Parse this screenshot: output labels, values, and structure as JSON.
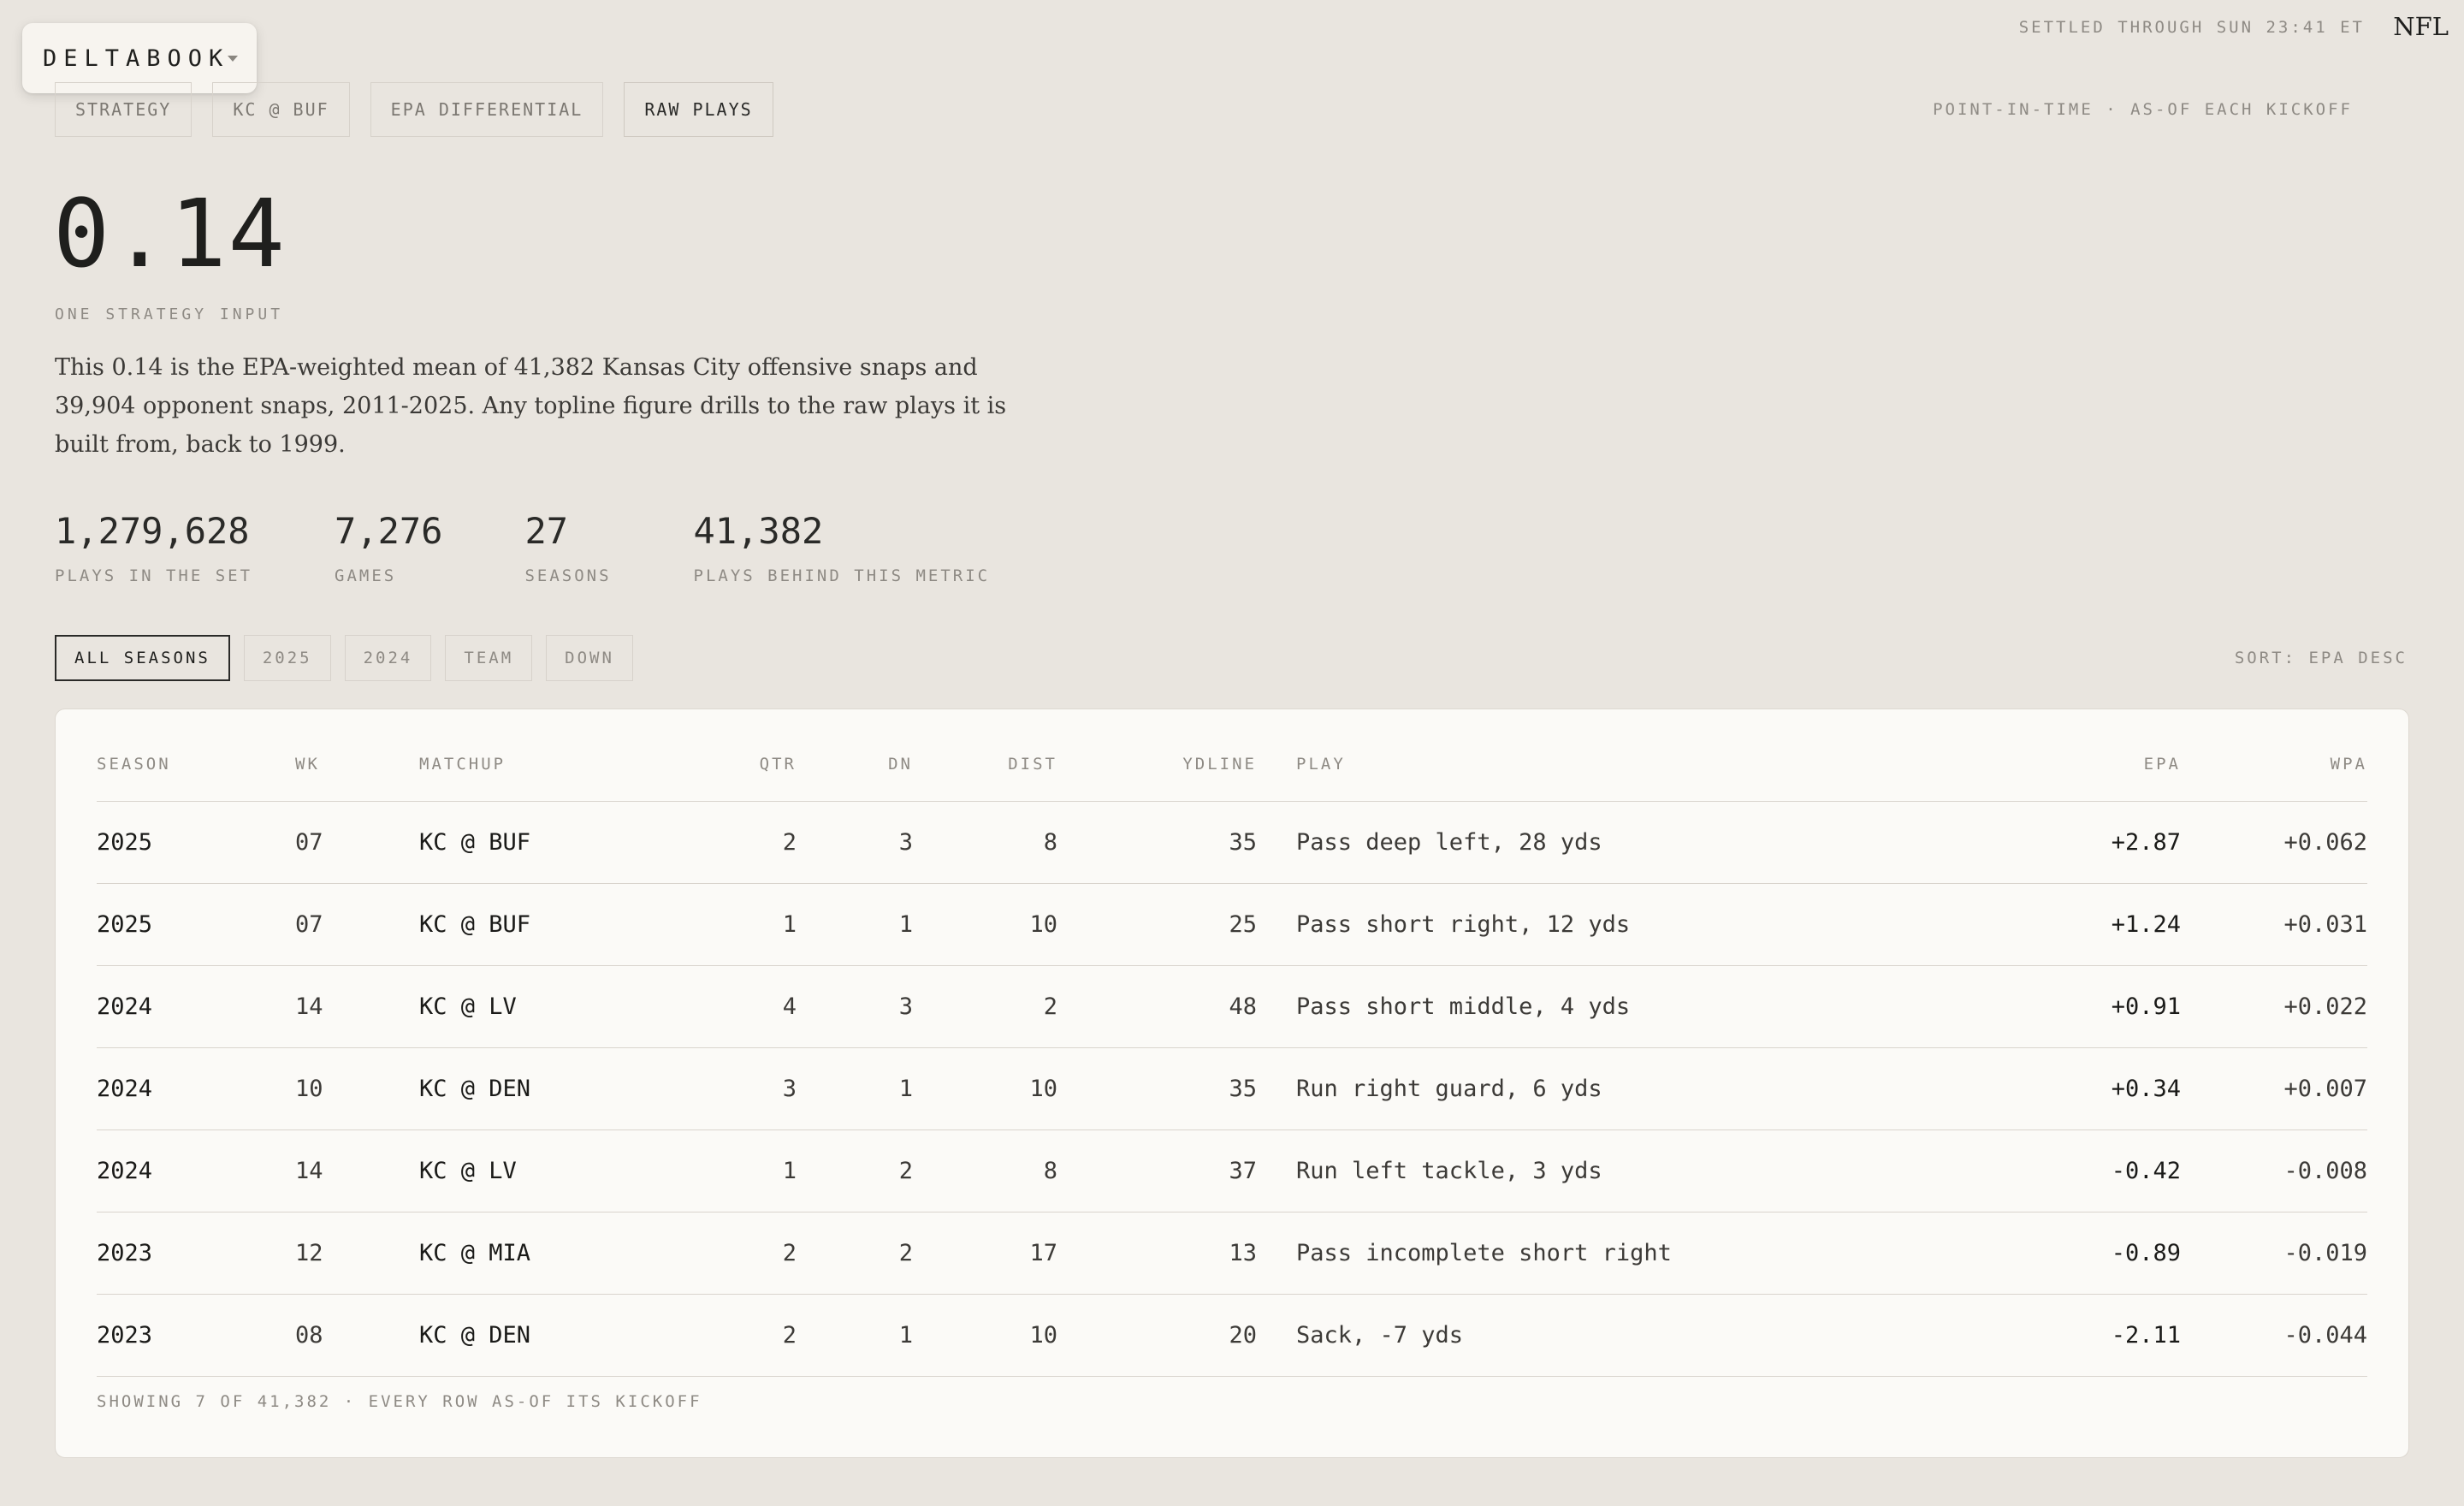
{
  "brand": {
    "name": "DELTABOOK",
    "caret_icon": "chevron-down-icon"
  },
  "status": {
    "settled": "SETTLED THROUGH SUN 23:41 ET",
    "league": "NFL"
  },
  "breadcrumbs": [
    {
      "label": "STRATEGY",
      "active": false
    },
    {
      "label": "KC @ BUF",
      "active": false
    },
    {
      "label": "EPA DIFFERENTIAL",
      "active": false
    },
    {
      "label": "RAW PLAYS",
      "active": true
    }
  ],
  "point_in_time": "POINT-IN-TIME · AS-OF EACH KICKOFF",
  "metric": {
    "value": "0.14",
    "caption": "ONE STRATEGY INPUT",
    "explainer": "This 0.14 is the EPA-weighted mean of 41,382 Kansas City offensive snaps and 39,904 opponent snaps, 2011-2025. Any topline figure drills to the raw plays it is built from, back to 1999."
  },
  "stats": [
    {
      "value": "1,279,628",
      "label": "PLAYS IN THE SET"
    },
    {
      "value": "7,276",
      "label": "GAMES"
    },
    {
      "value": "27",
      "label": "SEASONS"
    },
    {
      "value": "41,382",
      "label": "PLAYS BEHIND THIS METRIC"
    }
  ],
  "filters": [
    {
      "label": "ALL SEASONS",
      "active": true
    },
    {
      "label": "2025",
      "active": false
    },
    {
      "label": "2024",
      "active": false
    },
    {
      "label": "TEAM",
      "active": false
    },
    {
      "label": "DOWN",
      "active": false
    }
  ],
  "sort": "SORT: EPA DESC",
  "table": {
    "columns": {
      "season": "SEASON",
      "wk": "WK",
      "matchup": "MATCHUP",
      "qtr": "QTR",
      "dn": "DN",
      "dist": "DIST",
      "ydline": "YDLINE",
      "play": "PLAY",
      "epa": "EPA",
      "wpa": "WPA"
    },
    "rows": [
      {
        "season": "2025",
        "wk": "07",
        "matchup": "KC @ BUF",
        "qtr": "2",
        "dn": "3",
        "dist": "8",
        "ydline": "35",
        "play": "Pass deep left, 28 yds",
        "epa": "+2.87",
        "wpa": "+0.062"
      },
      {
        "season": "2025",
        "wk": "07",
        "matchup": "KC @ BUF",
        "qtr": "1",
        "dn": "1",
        "dist": "10",
        "ydline": "25",
        "play": "Pass short right, 12 yds",
        "epa": "+1.24",
        "wpa": "+0.031"
      },
      {
        "season": "2024",
        "wk": "14",
        "matchup": "KC @ LV",
        "qtr": "4",
        "dn": "3",
        "dist": "2",
        "ydline": "48",
        "play": "Pass short middle, 4 yds",
        "epa": "+0.91",
        "wpa": "+0.022"
      },
      {
        "season": "2024",
        "wk": "10",
        "matchup": "KC @ DEN",
        "qtr": "3",
        "dn": "1",
        "dist": "10",
        "ydline": "35",
        "play": "Run right guard, 6 yds",
        "epa": "+0.34",
        "wpa": "+0.007"
      },
      {
        "season": "2024",
        "wk": "14",
        "matchup": "KC @ LV",
        "qtr": "1",
        "dn": "2",
        "dist": "8",
        "ydline": "37",
        "play": "Run left tackle, 3 yds",
        "epa": "-0.42",
        "wpa": "-0.008"
      },
      {
        "season": "2023",
        "wk": "12",
        "matchup": "KC @ MIA",
        "qtr": "2",
        "dn": "2",
        "dist": "17",
        "ydline": "13",
        "play": "Pass incomplete short right",
        "epa": "-0.89",
        "wpa": "-0.019"
      },
      {
        "season": "2023",
        "wk": "08",
        "matchup": "KC @ DEN",
        "qtr": "2",
        "dn": "1",
        "dist": "10",
        "ydline": "20",
        "play": "Sack, -7 yds",
        "epa": "-2.11",
        "wpa": "-0.044"
      }
    ],
    "footer": "SHOWING 7 OF 41,382 · EVERY ROW AS-OF ITS KICKOFF"
  }
}
